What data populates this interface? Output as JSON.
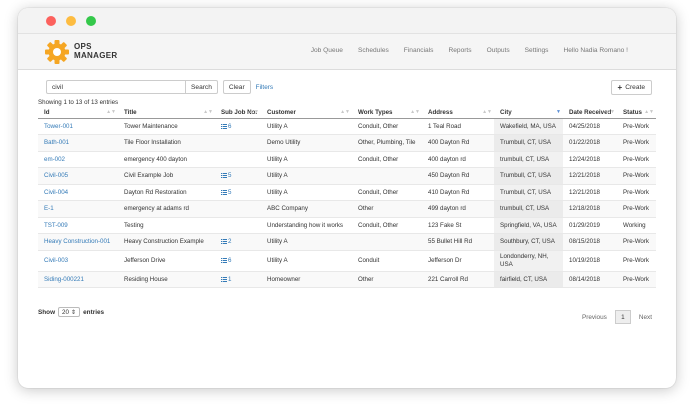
{
  "app": {
    "brand_line1": "OPS",
    "brand_line2": "MANAGER"
  },
  "nav": {
    "items": [
      "Job Queue",
      "Schedules",
      "Financials",
      "Reports",
      "Outputs",
      "Settings"
    ],
    "greeting": "Hello Nadia Romano !"
  },
  "toolbar": {
    "search_value": "civil",
    "search_label": "Search",
    "clear_label": "Clear",
    "filters_label": "Filters",
    "create_label": "Create"
  },
  "table": {
    "info": "Showing 1 to 13 of 13 entries",
    "headers": [
      "Id",
      "Title",
      "Sub Job No.",
      "Customer",
      "Work Types",
      "Address",
      "City",
      "Date Received",
      "Status"
    ],
    "rows": [
      {
        "id": "Tower-001",
        "title": "Tower Maintenance",
        "sub": "6",
        "customer": "Utility A",
        "work": "Conduit, Other",
        "address": "1 Teal Road",
        "city": "Wakefield, MA, USA",
        "date": "04/25/2018",
        "status": "Pre-Work"
      },
      {
        "id": "Bath-001",
        "title": "Tile Floor Installation",
        "sub": "",
        "customer": "Demo Utility",
        "work": "Other, Plumbing, Tile",
        "address": "400 Dayton Rd",
        "city": "Trumbull, CT, USA",
        "date": "01/22/2018",
        "status": "Pre-Work"
      },
      {
        "id": "em-002",
        "title": "emergency 400 dayton",
        "sub": "",
        "customer": "Utility A",
        "work": "Conduit, Other",
        "address": "400 dayton rd",
        "city": "trumbull, CT, USA",
        "date": "12/24/2018",
        "status": "Pre-Work"
      },
      {
        "id": "Civil-005",
        "title": "Civil Example Job",
        "sub": "5",
        "customer": "Utility A",
        "work": "",
        "address": "450 Dayton Rd",
        "city": "Trumbull, CT, USA",
        "date": "12/21/2018",
        "status": "Pre-Work"
      },
      {
        "id": "Civil-004",
        "title": "Dayton Rd Restoration",
        "sub": "5",
        "customer": "Utility A",
        "work": "Conduit, Other",
        "address": "410 Dayton Rd",
        "city": "Trumbull, CT, USA",
        "date": "12/21/2018",
        "status": "Pre-Work"
      },
      {
        "id": "E-1",
        "title": "emergency at adams rd",
        "sub": "",
        "customer": "ABC Company",
        "work": "Other",
        "address": "499 dayton rd",
        "city": "trumbull, CT, USA",
        "date": "12/18/2018",
        "status": "Pre-Work"
      },
      {
        "id": "TST-009",
        "title": "Testing",
        "sub": "",
        "customer": "Understanding how it works",
        "work": "Conduit, Other",
        "address": "123 Fake St",
        "city": "Springfield, VA, USA",
        "date": "01/29/2019",
        "status": "Working"
      },
      {
        "id": "Heavy Construction-001",
        "title": "Heavy Construction Example",
        "sub": "2",
        "customer": "Utility A",
        "work": "",
        "address": "55 Bullet Hill Rd",
        "city": "Southbury, CT, USA",
        "date": "08/15/2018",
        "status": "Pre-Work"
      },
      {
        "id": "Civil-003",
        "title": "Jefferson Drive",
        "sub": "6",
        "customer": "Utility A",
        "work": "Conduit",
        "address": "Jefferson Dr",
        "city": "Londonderry, NH, USA",
        "date": "10/19/2018",
        "status": "Pre-Work"
      },
      {
        "id": "Siding-000221",
        "title": "Residing House",
        "sub": "1",
        "customer": "Homeowner",
        "work": "Other",
        "address": "221 Carroll Rd",
        "city": "fairfield, CT, USA",
        "date": "08/14/2018",
        "status": "Pre-Work"
      }
    ]
  },
  "footer": {
    "show_label": "Show",
    "page_size": "20",
    "entries_label": "entries",
    "prev_label": "Previous",
    "page_number": "1",
    "next_label": "Next"
  },
  "colors": {
    "accent": "#f5a623",
    "link": "#337ab7"
  }
}
